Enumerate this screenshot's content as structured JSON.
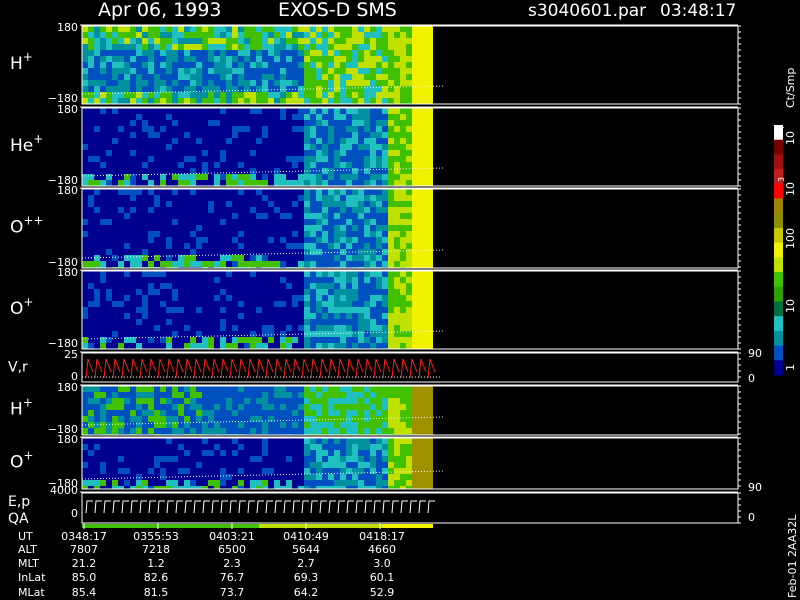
{
  "header": {
    "date": "Apr 06, 1993",
    "instrument": "EXOS-D SMS",
    "file": "s3040601.par",
    "time": "03:48:17"
  },
  "chart_data": {
    "type": "heatmap",
    "panels": [
      {
        "ion": "H",
        "charge": "+",
        "ylim": [
          -180,
          180
        ],
        "ytick_labels": [
          "180",
          "−180"
        ]
      },
      {
        "ion": "He",
        "charge": "+",
        "ylim": [
          -180,
          180
        ],
        "ytick_labels": [
          "180",
          "−180"
        ]
      },
      {
        "ion": "O",
        "charge": "++",
        "ylim": [
          -180,
          180
        ],
        "ytick_labels": [
          "180",
          "−180"
        ]
      },
      {
        "ion": "O",
        "charge": "+",
        "ylim": [
          -180,
          180
        ],
        "ytick_labels": [
          "180",
          "−180"
        ]
      },
      {
        "label": "V,r",
        "left_ticks": [
          "25",
          "0"
        ],
        "right_ticks": [
          "90",
          "0"
        ]
      },
      {
        "ion": "H",
        "charge": "+",
        "ylim": [
          -180,
          180
        ],
        "ytick_labels": [
          "180",
          "−180"
        ]
      },
      {
        "ion": "O",
        "charge": "+",
        "ylim": [
          -180,
          180
        ],
        "ytick_labels": [
          "180",
          "−180"
        ]
      },
      {
        "label": "E,p",
        "label2": "QA",
        "left_ticks": [
          "4000",
          "0"
        ],
        "right_ticks": [
          "90",
          "0"
        ]
      }
    ],
    "colorbar": {
      "unit": "Ct/Smp",
      "tick_labels": [
        "10",
        "4",
        "10",
        "3",
        "100",
        "10",
        "1"
      ],
      "colors": [
        "#ffffff",
        "#7a0000",
        "#a01010",
        "#c02020",
        "#ff0000",
        "#a08400",
        "#8c8c00",
        "#c8c800",
        "#f0f000",
        "#c0e000",
        "#40c000",
        "#30a000",
        "#006e40",
        "#20c0c0",
        "#0090a0",
        "#0050c0",
        "#000090"
      ]
    },
    "data_extent_fraction_of_time_axis": 0.535,
    "time_axis": {
      "rows": [
        {
          "label": "UT",
          "values": [
            "0348:17",
            "0355:53",
            "0403:21",
            "0410:49",
            "0418:17"
          ]
        },
        {
          "label": "ALT",
          "values": [
            "7807",
            "7218",
            "6500",
            "5644",
            "4660"
          ]
        },
        {
          "label": "MLT",
          "values": [
            "21.2",
            "1.2",
            "2.3",
            "2.7",
            "3.0"
          ]
        },
        {
          "label": "InLat",
          "values": [
            "85.0",
            "82.6",
            "76.7",
            "69.3",
            "60.1"
          ]
        },
        {
          "label": "MLat",
          "values": [
            "85.4",
            "81.5",
            "73.7",
            "64.2",
            "52.9"
          ]
        }
      ]
    }
  },
  "footer": {
    "stamp": "Feb-01 2AA32L"
  }
}
